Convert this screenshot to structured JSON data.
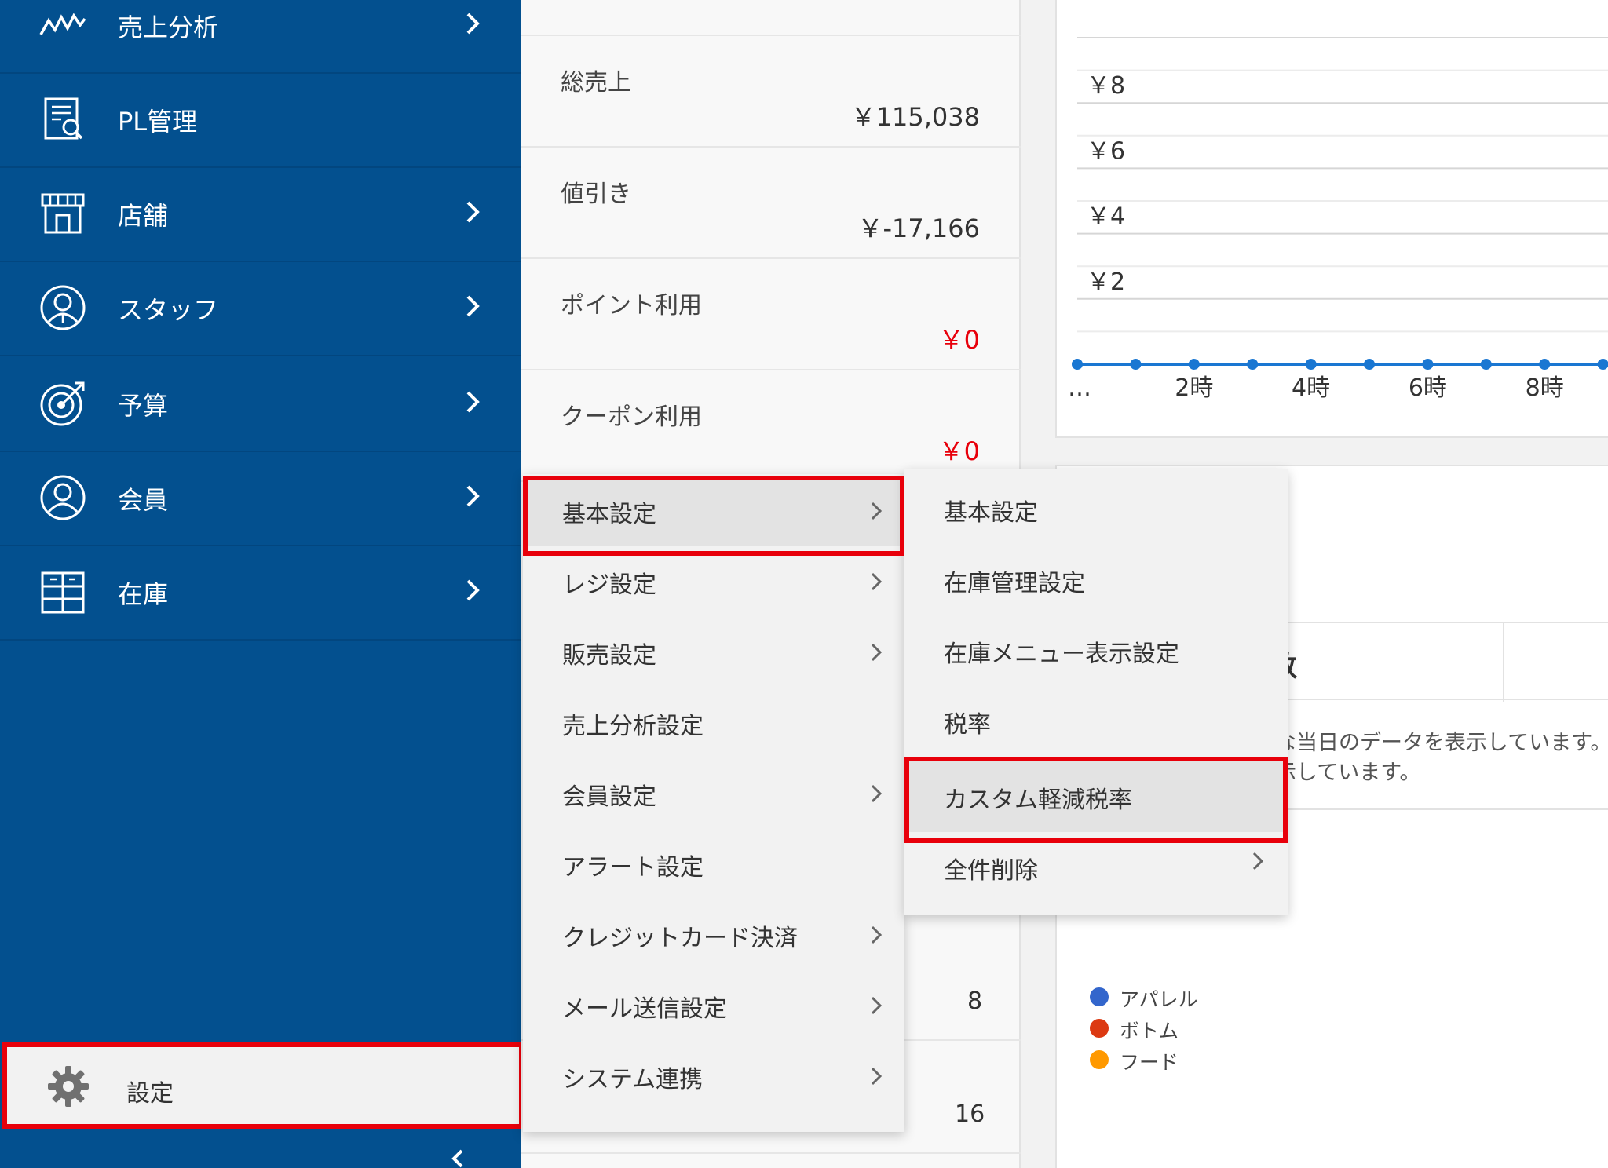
{
  "sidebar": {
    "items": [
      {
        "label": "売上分析",
        "icon": "sales-analysis-icon",
        "has_submenu": true
      },
      {
        "label": "PL管理",
        "icon": "pl-report-icon",
        "has_submenu": false
      },
      {
        "label": "店舗",
        "icon": "store-icon",
        "has_submenu": true
      },
      {
        "label": "スタッフ",
        "icon": "staff-icon",
        "has_submenu": true
      },
      {
        "label": "予算",
        "icon": "target-icon",
        "has_submenu": true
      },
      {
        "label": "会員",
        "icon": "member-icon",
        "has_submenu": true
      },
      {
        "label": "在庫",
        "icon": "inventory-icon",
        "has_submenu": true
      }
    ],
    "settings": {
      "label": "設定",
      "icon": "gear-icon"
    }
  },
  "summary": {
    "rows": [
      {
        "label": "総売上",
        "value": "￥115,038"
      },
      {
        "label": "値引き",
        "value": "￥-17,166"
      },
      {
        "label": "ポイント利用",
        "value": "￥0"
      },
      {
        "label": "クーポン利用",
        "value": "￥0"
      }
    ],
    "lower_values": [
      "8",
      "16"
    ]
  },
  "chart_data": {
    "type": "line",
    "y_ticks": [
      "￥8",
      "￥6",
      "￥4",
      "￥2"
    ],
    "x_ticks": [
      "…",
      "2時",
      "4時",
      "6時",
      "8時"
    ],
    "x": [
      0,
      1,
      2,
      3,
      4,
      5,
      6,
      7,
      8,
      9
    ],
    "series": [
      {
        "values": [
          0,
          0,
          0,
          0,
          0,
          0,
          0,
          0,
          0,
          0
        ]
      }
    ],
    "ylim": [
      0,
      10
    ],
    "grid": true,
    "line_color": "#1a77d2"
  },
  "lower_card": {
    "header_text": "数",
    "note_line1": "な当日のデータを表示しています。",
    "note_line2": "示しています。",
    "legend": [
      {
        "label": "アパレル",
        "color": "#3366cc"
      },
      {
        "label": "ボトム",
        "color": "#dc3912"
      },
      {
        "label": "フード",
        "color": "#ff9900"
      }
    ]
  },
  "menu_level1": {
    "items": [
      {
        "label": "基本設定",
        "has_submenu": true,
        "active": true
      },
      {
        "label": "レジ設定",
        "has_submenu": true
      },
      {
        "label": "販売設定",
        "has_submenu": true
      },
      {
        "label": "売上分析設定",
        "has_submenu": false
      },
      {
        "label": "会員設定",
        "has_submenu": true
      },
      {
        "label": "アラート設定",
        "has_submenu": false
      },
      {
        "label": "クレジットカード決済",
        "has_submenu": true
      },
      {
        "label": "メール送信設定",
        "has_submenu": true
      },
      {
        "label": "システム連携",
        "has_submenu": true
      }
    ]
  },
  "menu_level2": {
    "items": [
      {
        "label": "基本設定",
        "has_submenu": false
      },
      {
        "label": "在庫管理設定",
        "has_submenu": false
      },
      {
        "label": "在庫メニュー表示設定",
        "has_submenu": false
      },
      {
        "label": "税率",
        "has_submenu": false
      },
      {
        "label": "カスタム軽減税率",
        "has_submenu": false,
        "active": true
      },
      {
        "label": "全件削除",
        "has_submenu": true
      }
    ]
  },
  "colors": {
    "sidebar_bg": "#03508f",
    "highlight": "#e8000b",
    "negative": "#e8000b"
  }
}
